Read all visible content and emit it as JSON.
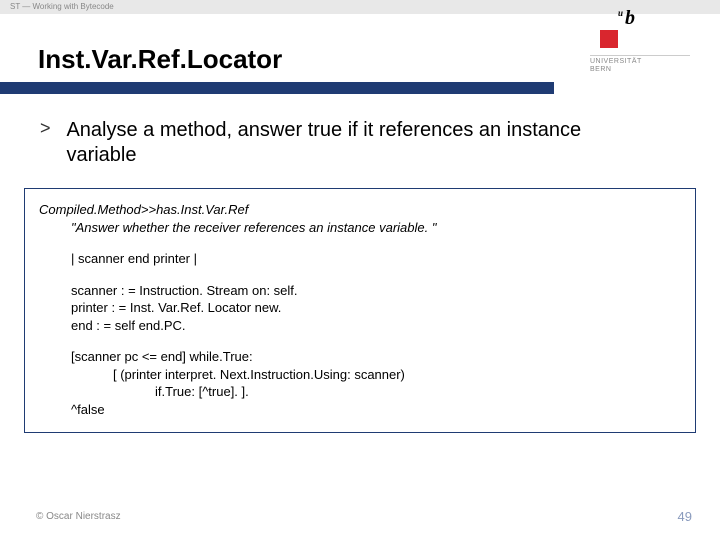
{
  "header": {
    "breadcrumb": "ST — Working with Bytecode"
  },
  "logo": {
    "u": "u",
    "b": "b",
    "line1": "UNIVERSITÄT",
    "line2": "BERN"
  },
  "title": "Inst.Var.Ref.Locator",
  "bullet": {
    "marker": ">",
    "text": "Analyse a method, answer true if it references an instance variable"
  },
  "code": {
    "signature": "Compiled.Method>>has.Inst.Var.Ref",
    "comment": "\"Answer whether the receiver references an instance variable. \"",
    "l1": "| scanner end printer |",
    "l2": "scanner : = Instruction. Stream on: self.",
    "l3": "printer : = Inst. Var.Ref. Locator new.",
    "l4": "end : = self end.PC.",
    "l5": "[scanner pc <= end] while.True:",
    "l6": "[ (printer interpret. Next.Instruction.Using: scanner)",
    "l7": "if.True: [^true]. ].",
    "l8": "^false"
  },
  "footer": {
    "copyright": "© Oscar Nierstrasz",
    "page": "49"
  }
}
